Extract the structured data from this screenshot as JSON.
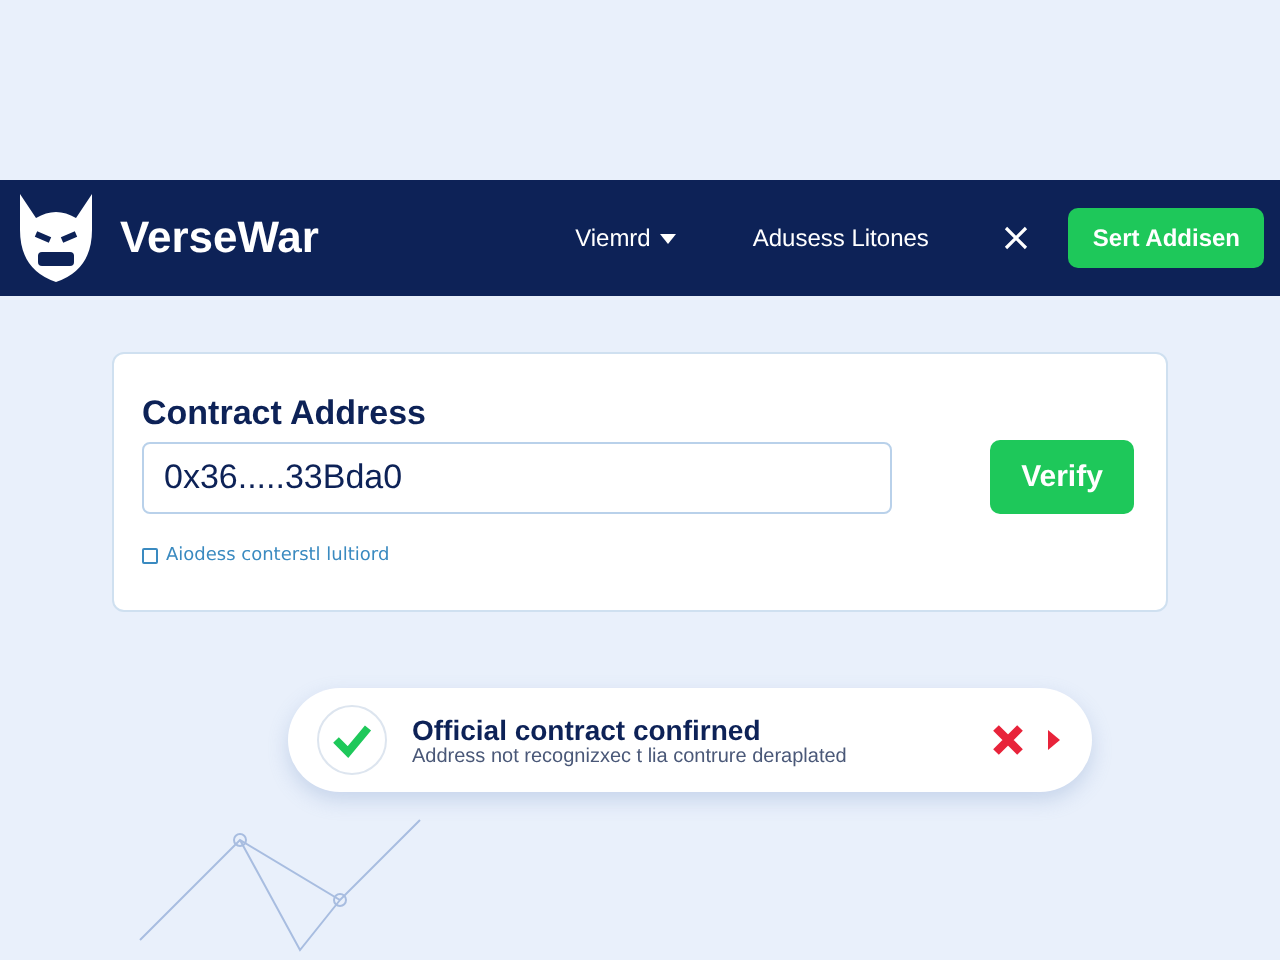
{
  "navbar": {
    "brand": "VerseWar",
    "menu": [
      {
        "label": "Viemrd",
        "kind": "dropdown"
      },
      {
        "label": "Adusess Litones",
        "kind": "link"
      }
    ],
    "action_button": "Sert Addisen"
  },
  "card": {
    "title": "Contract Address",
    "address": {
      "value": "0x36.....33Bda0"
    },
    "verify_button": "Verify",
    "checkbox": {
      "label": "Aiodess conterstl lultiord",
      "checked": false
    }
  },
  "toast": {
    "title": "Official contract confirned",
    "message": "Address not recognizxec t lia contrure deraplated"
  }
}
